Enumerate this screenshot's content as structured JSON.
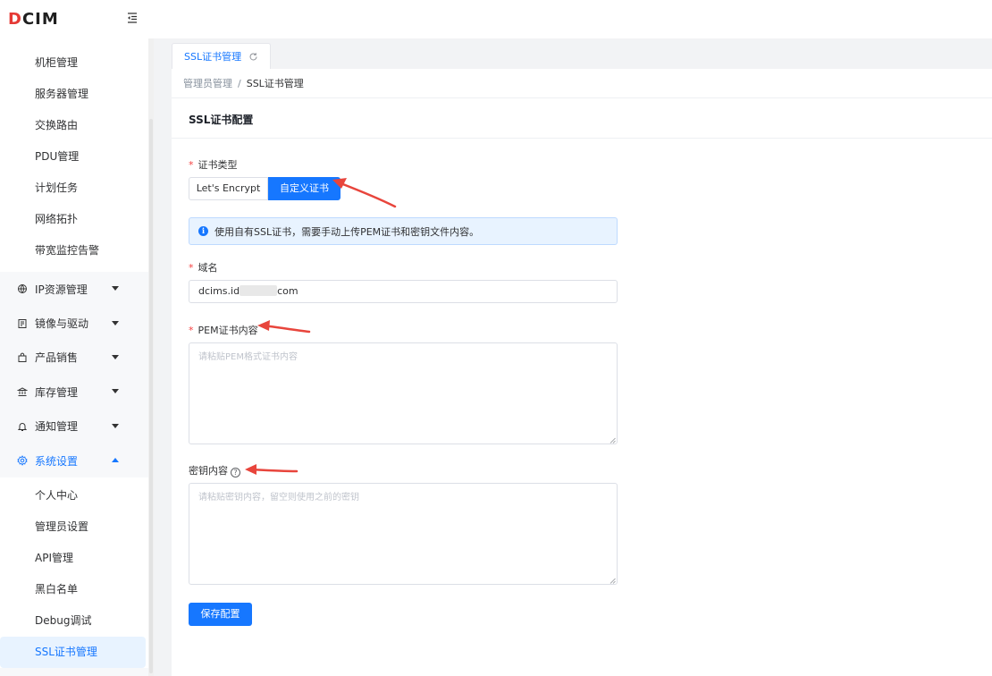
{
  "app": {
    "logo_prefix": "D",
    "logo_text": "CIM"
  },
  "sidebar": {
    "sub_items_top": [
      "机柜管理",
      "服务器管理",
      "交换路由",
      "PDU管理",
      "计划任务",
      "网络拓扑",
      "带宽监控告警"
    ],
    "groups": [
      {
        "label": "IP资源管理",
        "icon": "network-icon"
      },
      {
        "label": "镜像与驱动",
        "icon": "image-icon"
      },
      {
        "label": "产品销售",
        "icon": "bag-icon"
      },
      {
        "label": "库存管理",
        "icon": "bank-icon"
      },
      {
        "label": "通知管理",
        "icon": "bell-icon"
      },
      {
        "label": "系统设置",
        "icon": "gear-icon"
      }
    ],
    "sub_items_settings": [
      "个人中心",
      "管理员设置",
      "API管理",
      "黑白名单",
      "Debug调试",
      "SSL证书管理"
    ]
  },
  "tabs": [
    {
      "label": "SSL证书管理"
    }
  ],
  "breadcrumb": {
    "parent": "管理员管理",
    "separator": "/",
    "current": "SSL证书管理"
  },
  "card": {
    "title": "SSL证书配置"
  },
  "form": {
    "cert_type": {
      "label": "证书类型",
      "options": [
        "Let's Encrypt",
        "自定义证书"
      ],
      "selected": "自定义证书"
    },
    "alert_text": "使用自有SSL证书，需要手动上传PEM证书和密钥文件内容。",
    "domain": {
      "label": "域名",
      "value_prefix": "dcims.id",
      "value_suffix": "com"
    },
    "pem": {
      "label": "PEM证书内容",
      "placeholder": "请粘贴PEM格式证书内容"
    },
    "key": {
      "label": "密钥内容",
      "placeholder": "请粘贴密钥内容，留空则使用之前的密钥"
    },
    "save_label": "保存配置"
  },
  "colors": {
    "primary": "#1677ff",
    "required": "#f53f3f",
    "annotation_arrow": "#e8453c"
  }
}
